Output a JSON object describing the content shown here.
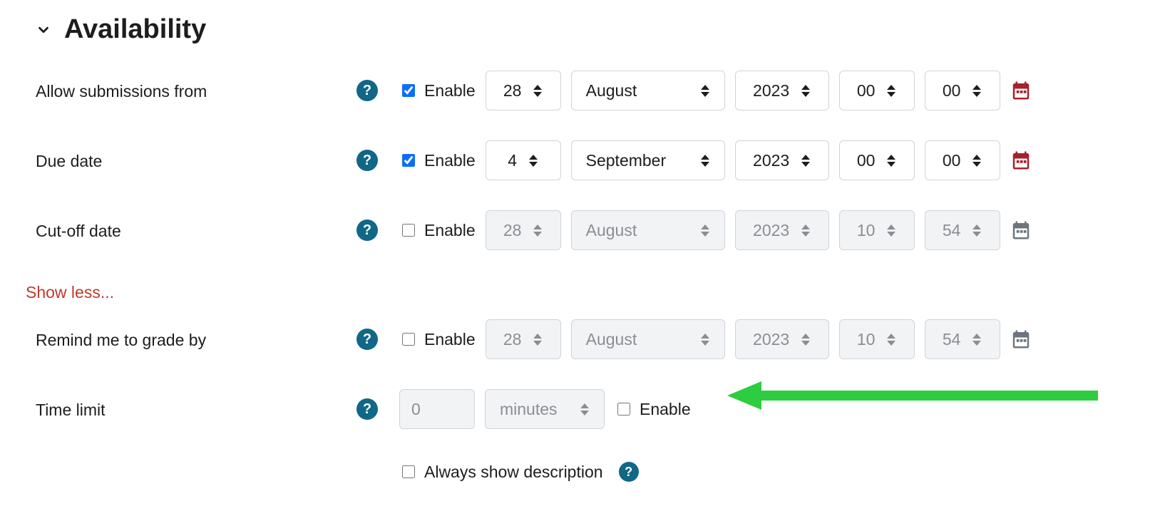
{
  "section": {
    "title": "Availability"
  },
  "labels": {
    "allow_from": "Allow submissions from",
    "due_date": "Due date",
    "cutoff": "Cut-off date",
    "remind": "Remind me to grade by",
    "time_limit": "Time limit",
    "enable": "Enable",
    "show_less": "Show less...",
    "always_show_desc": "Always show description"
  },
  "allow_from": {
    "enabled": true,
    "day": "28",
    "month": "August",
    "year": "2023",
    "hour": "00",
    "minute": "00"
  },
  "due_date": {
    "enabled": true,
    "day": "4",
    "month": "September",
    "year": "2023",
    "hour": "00",
    "minute": "00"
  },
  "cutoff": {
    "enabled": false,
    "day": "28",
    "month": "August",
    "year": "2023",
    "hour": "10",
    "minute": "54"
  },
  "remind": {
    "enabled": false,
    "day": "28",
    "month": "August",
    "year": "2023",
    "hour": "10",
    "minute": "54"
  },
  "time_limit": {
    "value": "0",
    "unit": "minutes",
    "enabled": false
  },
  "always_show_description": {
    "checked": false
  }
}
